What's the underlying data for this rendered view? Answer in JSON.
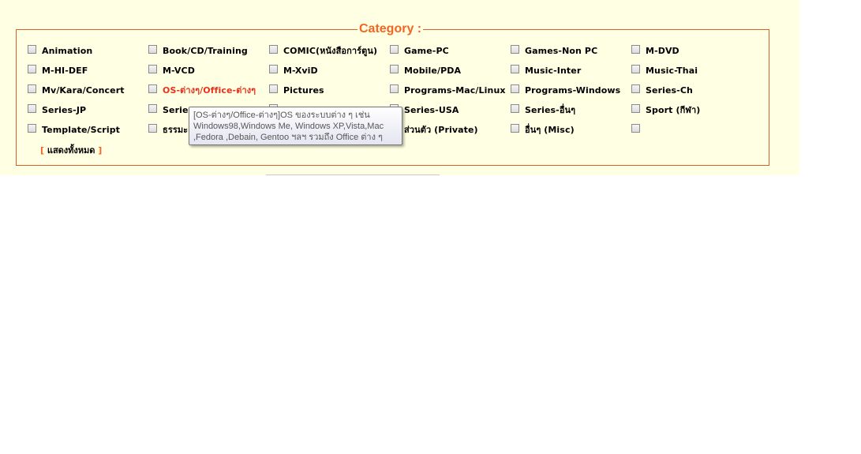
{
  "category": {
    "legend": "Category :",
    "show_all_open": "[ ",
    "show_all_label": "แสดงทั้งหมด",
    "show_all_close": " ]",
    "highlight_color": "#e8321e",
    "accent_color": "#f26522",
    "items": [
      "Animation",
      "Book/CD/Training",
      "COMIC(หนังสือการ์ตูน)",
      "Game-PC",
      "Games-Non PC",
      "M-DVD",
      "M-HI-DEF",
      "M-VCD",
      "M-XviD",
      "Mobile/PDA",
      "Music-Inter",
      "Music-Thai",
      "Mv/Kara/Concert",
      "OS-ต่างๆ/Office-ต่างๆ",
      "Pictures",
      "Programs-Mac/Linux",
      "Programs-Windows",
      "Series-Ch",
      "Series-JP",
      "Series",
      "",
      "Series-USA",
      "Series-อื่นๆ",
      "Sport (กีฬา)",
      "Template/Script",
      "ธรรมะ",
      "",
      "ส่วนตัว (Private)",
      "อื่นๆ (Misc)",
      ""
    ]
  },
  "tooltip": {
    "line1": "[OS-ต่างๆ/Office-ต่างๆ]OS ของระบบต่าง ๆ  เช่น",
    "line2": "Windows98,Windows Me, Windows XP,Vista,Mac",
    "line3": ",Fedora ,Debain, Gentoo ฯลฯ รวมถึง Office ต่าง ๆ"
  }
}
